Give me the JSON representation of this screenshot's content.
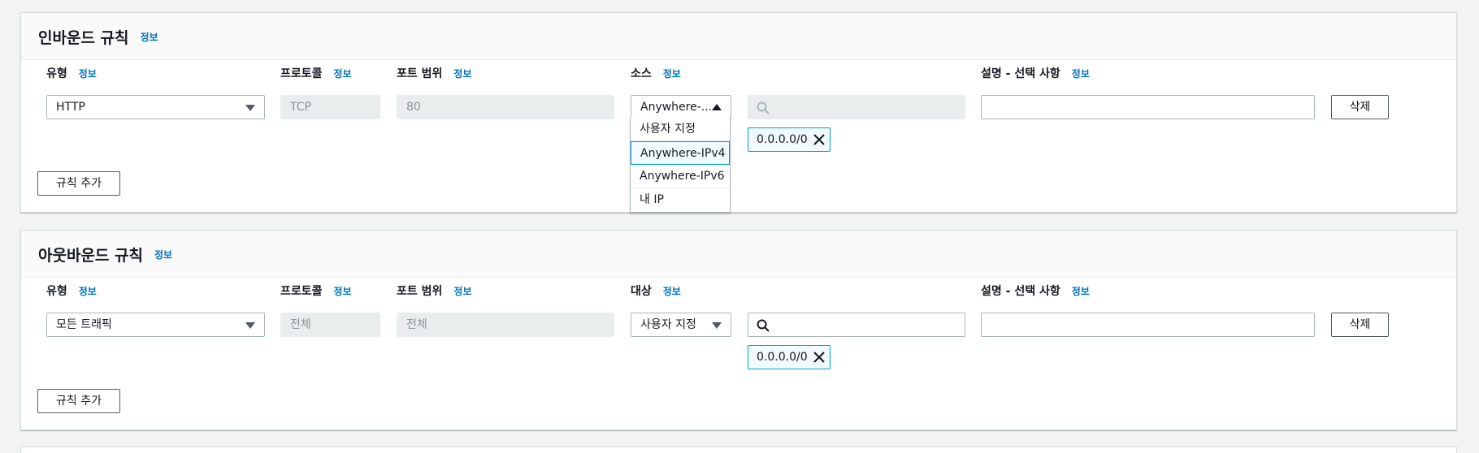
{
  "inbound": {
    "title": "인바운드 규칙",
    "info": "정보",
    "labels": {
      "type": "유형",
      "protocol": "프로토콜",
      "port": "포트 범위",
      "source": "소스",
      "description": "설명 - 선택 사항"
    },
    "rule": {
      "type": "HTTP",
      "protocol": "TCP",
      "port": "80",
      "source": "Anywhere-...",
      "cidr_token": "0.0.0.0/0",
      "description": ""
    },
    "source_options": [
      "사용자 지정",
      "Anywhere-IPv4",
      "Anywhere-IPv6",
      "내 IP"
    ],
    "selected_option": "Anywhere-IPv4",
    "delete_label": "삭제",
    "add_rule_label": "규칙 추가"
  },
  "outbound": {
    "title": "아웃바운드 규칙",
    "info": "정보",
    "labels": {
      "type": "유형",
      "protocol": "프로토콜",
      "port": "포트 범위",
      "destination": "대상",
      "description": "설명 - 선택 사항"
    },
    "rule": {
      "type": "모든 트래픽",
      "protocol": "전체",
      "port": "전체",
      "destination": "사용자 지정",
      "cidr_token": "0.0.0.0/0",
      "description": ""
    },
    "delete_label": "삭제",
    "add_rule_label": "규칙 추가"
  },
  "colors": {
    "link": "#0073bb",
    "token_border": "#00a1c9",
    "disabled_bg": "#eaeded"
  }
}
